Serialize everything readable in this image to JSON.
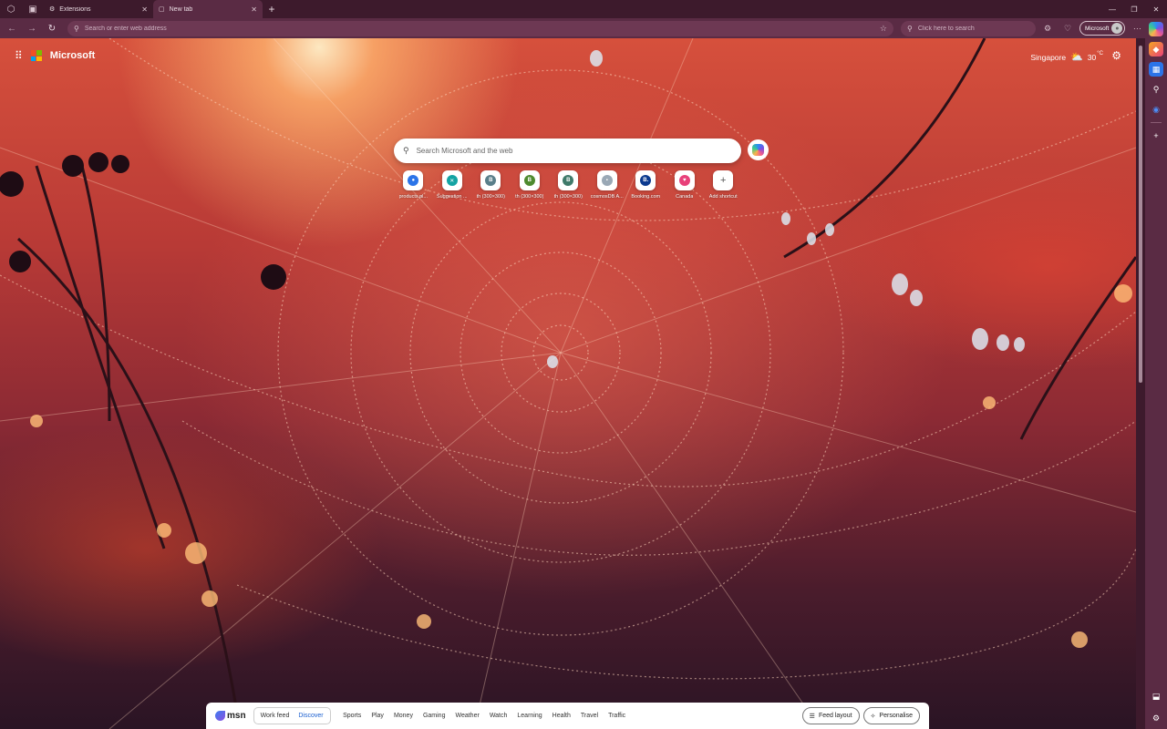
{
  "tabs": [
    {
      "title": "Extensions",
      "active": false
    },
    {
      "title": "New tab",
      "active": true
    }
  ],
  "toolbar": {
    "address_placeholder": "Search or enter web address",
    "search_placeholder": "Click here to search",
    "profile_label": "Microsoft"
  },
  "page": {
    "brand": "Microsoft",
    "weather": {
      "city": "Singapore",
      "temp": "30",
      "unit": "°C"
    },
    "search_placeholder": "Search Microsoft and the web"
  },
  "shortcuts": [
    {
      "label": "products.pl...",
      "glyph": "●",
      "color": "#2b74e8"
    },
    {
      "label": "Suggestion ...",
      "glyph": "✕",
      "color": "#14a3a3"
    },
    {
      "label": "th (300×300)",
      "glyph": "B",
      "color": "#5a7f8a"
    },
    {
      "label": "th (300×300)",
      "glyph": "B",
      "color": "#4e8a2e"
    },
    {
      "label": "th (300×300)",
      "glyph": "B",
      "color": "#3f7a6a"
    },
    {
      "label": "cosmosDB A...",
      "glyph": "▪",
      "color": "#9aa8b5"
    },
    {
      "label": "Booking.com",
      "glyph": "B.",
      "color": "#0b3a8f"
    },
    {
      "label": "Canada",
      "glyph": "♥",
      "color": "#e8407a"
    },
    {
      "label": "Add shortcut",
      "glyph": "+",
      "color": "#ffffff"
    }
  ],
  "msn": {
    "logo": "msn",
    "feed_tabs": [
      "Work feed",
      "Discover"
    ],
    "active_feed": "Discover",
    "categories": [
      "Sports",
      "Play",
      "Money",
      "Gaming",
      "Weather",
      "Watch",
      "Learning",
      "Health",
      "Travel",
      "Traffic"
    ],
    "feed_layout_label": "Feed layout",
    "personalise_label": "Personalise"
  },
  "colors": {
    "accent": "#5a2b44",
    "titlebar": "#3d1a2c",
    "active_feed": "#1a5fd0"
  }
}
